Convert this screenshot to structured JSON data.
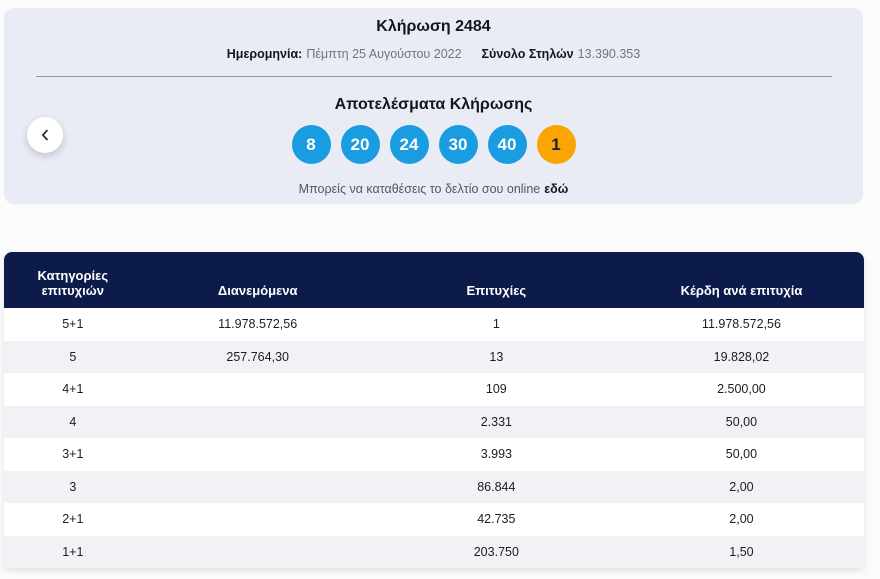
{
  "draw": {
    "title": "Κλήρωση 2484",
    "date_label": "Ημερομηνία:",
    "date_value": "Πέμπτη 25 Αυγούστου 2022",
    "columns_label": "Σύνολο Στηλών",
    "columns_value": "13.390.353",
    "results_title": "Αποτελέσματα Κλήρωσης",
    "numbers": [
      "8",
      "20",
      "24",
      "30",
      "40"
    ],
    "tzoker_number": "1",
    "online_text": "Μπορείς να καταθέσεις το δελτίο σου online",
    "online_link_label": "εδώ"
  },
  "colors": {
    "card_background": "#e9ecf5",
    "number_ball_blue": "#1a9ce0",
    "tzoker_ball_orange": "#faa502",
    "table_header_navy": "#0d1b4b",
    "stripe_row": "#f1f2f6"
  },
  "table": {
    "headers": [
      {
        "lines": [
          "Κατηγορίες",
          "επιτυχιών"
        ]
      },
      {
        "lines": [
          "Διανεμόμενα"
        ]
      },
      {
        "lines": [
          "Επιτυχίες"
        ]
      },
      {
        "lines": [
          "Κέρδη ανά επιτυχία"
        ]
      }
    ],
    "rows": [
      {
        "category": "5+1",
        "distributed": "11.978.572,56",
        "winners": "1",
        "prize": "11.978.572,56"
      },
      {
        "category": "5",
        "distributed": "257.764,30",
        "winners": "13",
        "prize": "19.828,02"
      },
      {
        "category": "4+1",
        "distributed": "",
        "winners": "109",
        "prize": "2.500,00"
      },
      {
        "category": "4",
        "distributed": "",
        "winners": "2.331",
        "prize": "50,00"
      },
      {
        "category": "3+1",
        "distributed": "",
        "winners": "3.993",
        "prize": "50,00"
      },
      {
        "category": "3",
        "distributed": "",
        "winners": "86.844",
        "prize": "2,00"
      },
      {
        "category": "2+1",
        "distributed": "",
        "winners": "42.735",
        "prize": "2,00"
      },
      {
        "category": "1+1",
        "distributed": "",
        "winners": "203.750",
        "prize": "1,50"
      }
    ]
  }
}
